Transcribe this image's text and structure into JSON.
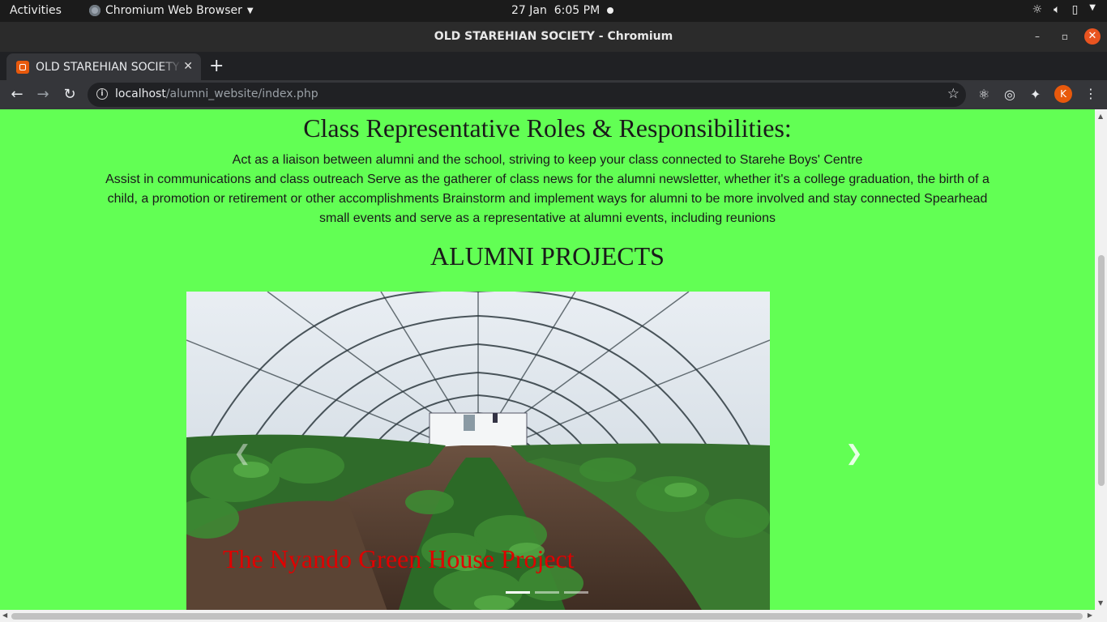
{
  "system": {
    "activities": "Activities",
    "app_name": "Chromium Web Browser",
    "date": "27 Jan",
    "time": "6:05 PM"
  },
  "window": {
    "title": "OLD STAREHIAN SOCIETY - Chromium"
  },
  "tab": {
    "title": "OLD STAREHIAN SOCIETY"
  },
  "address": {
    "host": "localhost",
    "path": "/alumni_website/index.php"
  },
  "profile": {
    "initial": "K"
  },
  "page": {
    "roles_heading": "Class Representative Roles & Responsibilities:",
    "roles_line1": "Act as a liaison between alumni and the school, striving to keep your class connected to Starehe Boys' Centre",
    "roles_line2": "Assist in communications and class outreach Serve as the gatherer of class news for the alumni newsletter, whether it's a college graduation, the birth of a child, a promotion or retirement or other accomplishments Brainstorm and implement ways for alumni to be more involved and stay connected Spearhead small events and serve as a representative at alumni events, including reunions",
    "projects_heading": "ALUMNI PROJECTS",
    "carousel": {
      "caption": "The Nyando Green House Project",
      "slide_count": 3,
      "active_index": 0
    }
  },
  "colors": {
    "page_background": "#62ff54",
    "caption": "#e00000",
    "accent": "#e95420"
  }
}
